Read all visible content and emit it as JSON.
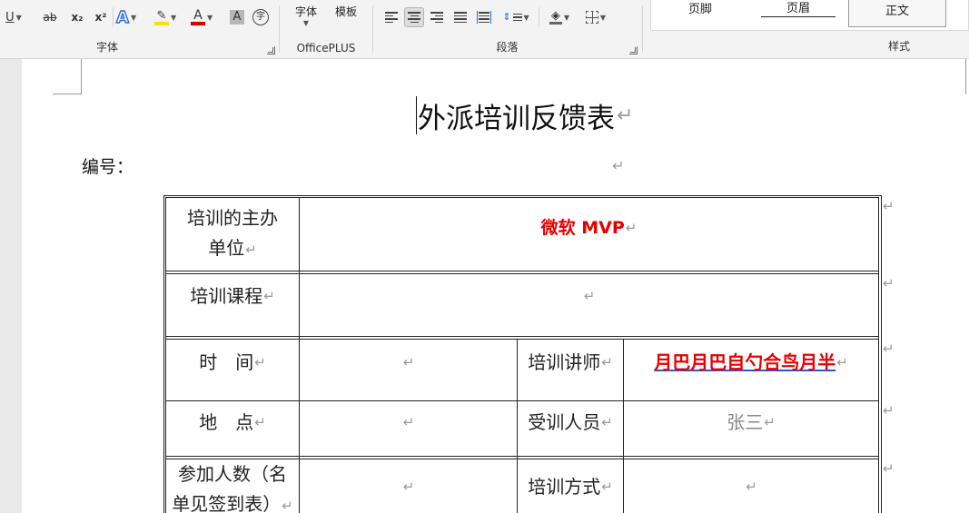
{
  "ribbon": {
    "font_group": {
      "label": "字体",
      "buttons": [
        {
          "name": "underline-button",
          "glyph": "U"
        },
        {
          "name": "strikethrough-button",
          "glyph": "ab"
        },
        {
          "name": "subscript-button",
          "glyph": "x₂"
        },
        {
          "name": "superscript-button",
          "glyph": "x²"
        },
        {
          "name": "text-effects-button",
          "glyph": "A"
        },
        {
          "name": "highlight-button",
          "glyph": "✎"
        },
        {
          "name": "font-color-button",
          "glyph": "A"
        },
        {
          "name": "char-shading-button",
          "glyph": "A"
        },
        {
          "name": "enclose-char-button",
          "glyph": "字"
        }
      ]
    },
    "officeplus_group": {
      "label": "OfficePLUS",
      "font_label": "字体",
      "template_label": "模板"
    },
    "paragraph_group": {
      "label": "段落"
    },
    "styles_group": {
      "label": "样式",
      "items": [
        "页脚",
        "页眉",
        "正文"
      ]
    },
    "colors": {
      "highlight": "#f5e400",
      "font_color": "#d00000",
      "accent_blue": "#2b6cd3"
    }
  },
  "document": {
    "title": "外派培训反馈表",
    "serial_label": "编号：",
    "paragraph_mark": "↵",
    "table": {
      "organizer_label": "培训的主办单位",
      "organizer_value": "微软 MVP",
      "course_label": "培训课程",
      "course_value": "",
      "time_label": "时　间",
      "time_value": "",
      "lecturer_label": "培训讲师",
      "lecturer_value": "月巴月巴自勺合鸟月半",
      "place_label": "地　点",
      "place_value": "",
      "trainee_label": "受训人员",
      "trainee_value": "张三",
      "count_label": "参加人数（名单见签到表）",
      "count_value": "",
      "method_label": "培训方式",
      "method_value": ""
    }
  }
}
